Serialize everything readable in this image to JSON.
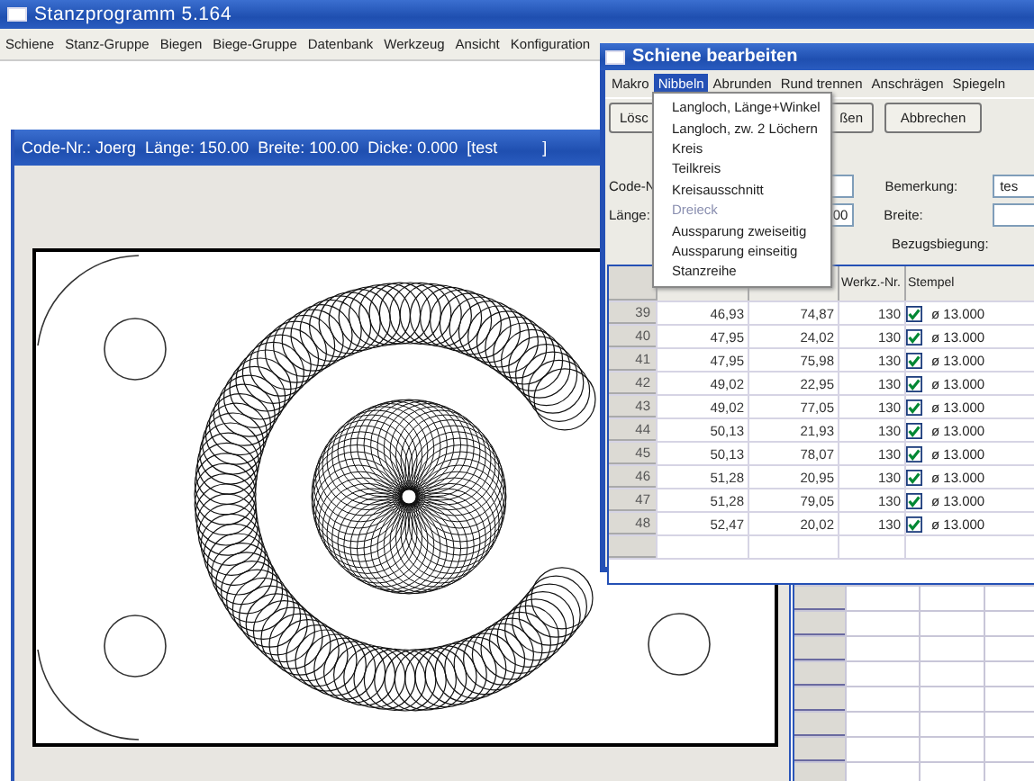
{
  "main_window": {
    "title": "Stanzprogramm 5.164",
    "menu": [
      {
        "label": "Schiene"
      },
      {
        "label": "Stanz-Gruppe"
      },
      {
        "label": "Biegen"
      },
      {
        "label": "Biege-Gruppe"
      },
      {
        "label": "Datenbank"
      },
      {
        "label": "Werkzeug"
      },
      {
        "label": "Ansicht"
      },
      {
        "label": "Konfiguration"
      }
    ]
  },
  "document_window": {
    "title": "Code-Nr.: Joerg  Länge: 150.00  Breite: 100.00  Dicke: 0.000  [test          ]"
  },
  "dialog": {
    "title": "Schiene bearbeiten",
    "menu": [
      {
        "label": "Makro",
        "selected": false
      },
      {
        "label": "Nibbeln",
        "selected": true
      },
      {
        "label": "Abrunden",
        "selected": false
      },
      {
        "label": "Rund trennen",
        "selected": false
      },
      {
        "label": "Anschrägen",
        "selected": false
      },
      {
        "label": "Spiegeln",
        "selected": false
      }
    ],
    "open_menu": [
      {
        "label": "Langloch, Länge+Winkel",
        "disabled": false
      },
      {
        "label": "Langloch, zw. 2 Löchern",
        "disabled": false
      },
      {
        "label": "Kreis",
        "disabled": false
      },
      {
        "label": "Teilkreis",
        "disabled": false
      },
      {
        "label": "Kreisausschnitt",
        "disabled": false
      },
      {
        "label": "Dreieck",
        "disabled": true
      },
      {
        "label": "Aussparung zweiseitig",
        "disabled": false
      },
      {
        "label": "Aussparung einseitig",
        "disabled": false
      },
      {
        "label": "Stanzreihe",
        "disabled": false
      }
    ],
    "buttons": [
      "Lösc",
      "ßen",
      "Abbrechen"
    ],
    "fields": {
      "code_label": "Code-N",
      "laenge_label": "Länge:",
      "laenge_value": "00",
      "bemerkung_label": "Bemerkung:",
      "bemerkung_value": "tes",
      "breite_label": "Breite:",
      "bezugsbiegung_label": "Bezugsbiegung:"
    },
    "table": {
      "columns": [
        "Werkz.-Nr.",
        "Stempel"
      ],
      "rows": [
        {
          "number": "39",
          "column_1": "46,93",
          "column_2": "74,87",
          "werkz_nr": "130",
          "checked": true,
          "stempel": "ø 13.000"
        },
        {
          "number": "40",
          "column_1": "47,95",
          "column_2": "24,02",
          "werkz_nr": "130",
          "checked": true,
          "stempel": "ø 13.000"
        },
        {
          "number": "41",
          "column_1": "47,95",
          "column_2": "75,98",
          "werkz_nr": "130",
          "checked": true,
          "stempel": "ø 13.000"
        },
        {
          "number": "42",
          "column_1": "49,02",
          "column_2": "22,95",
          "werkz_nr": "130",
          "checked": true,
          "stempel": "ø 13.000"
        },
        {
          "number": "43",
          "column_1": "49,02",
          "column_2": "77,05",
          "werkz_nr": "130",
          "checked": true,
          "stempel": "ø 13.000"
        },
        {
          "number": "44",
          "column_1": "50,13",
          "column_2": "21,93",
          "werkz_nr": "130",
          "checked": true,
          "stempel": "ø 13.000"
        },
        {
          "number": "45",
          "column_1": "50,13",
          "column_2": "78,07",
          "werkz_nr": "130",
          "checked": true,
          "stempel": "ø 13.000"
        },
        {
          "number": "46",
          "column_1": "51,28",
          "column_2": "20,95",
          "werkz_nr": "130",
          "checked": true,
          "stempel": "ø 13.000"
        },
        {
          "number": "47",
          "column_1": "51,28",
          "column_2": "79,05",
          "werkz_nr": "130",
          "checked": true,
          "stempel": "ø 13.000"
        },
        {
          "number": "48",
          "column_1": "52,47",
          "column_2": "20,02",
          "werkz_nr": "130",
          "checked": true,
          "stempel": "ø 13.000"
        }
      ]
    }
  }
}
